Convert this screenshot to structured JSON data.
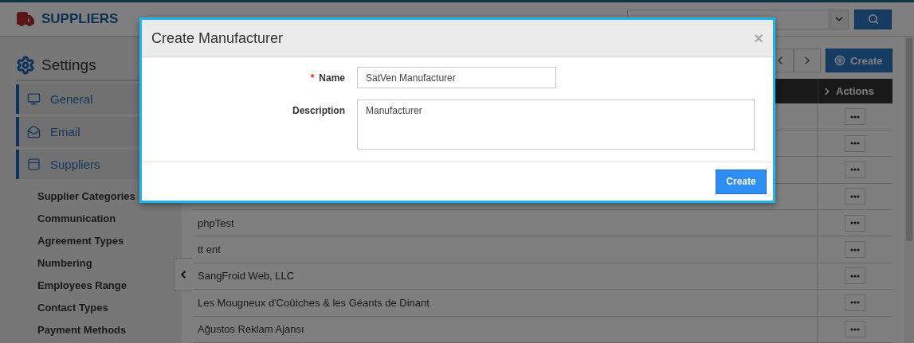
{
  "header": {
    "title": "SUPPLIERS"
  },
  "sidebar": {
    "title": "Settings",
    "items": [
      {
        "label": "General"
      },
      {
        "label": "Email"
      },
      {
        "label": "Suppliers"
      }
    ],
    "subitems": [
      "Supplier Categories",
      "Communication",
      "Agreement Types",
      "Numbering",
      "Employees Range",
      "Contact Types",
      "Payment Methods"
    ]
  },
  "toolbar": {
    "create": "Create"
  },
  "table": {
    "columns": [
      {
        "label": "Actions"
      }
    ],
    "rows": [
      {},
      {},
      {},
      {},
      {
        "name": "phpTest"
      },
      {
        "name": "tt ent"
      },
      {
        "name": "SangFroid Web, LLC"
      },
      {
        "name": "Les Mougneux d'Coûtches & les Géants de Dinant"
      },
      {
        "name": "Ağustos Reklam Ajansı"
      }
    ]
  },
  "modal": {
    "title": "Create Manufacturer",
    "close": "×",
    "required_mark": "*",
    "fields": [
      {
        "kind": "input",
        "label": "Name",
        "required": true,
        "value": "SatVen Manufacturer"
      },
      {
        "kind": "textarea",
        "label": "Description",
        "required": false,
        "value": "Manufacturer"
      }
    ],
    "submit": "Create"
  }
}
